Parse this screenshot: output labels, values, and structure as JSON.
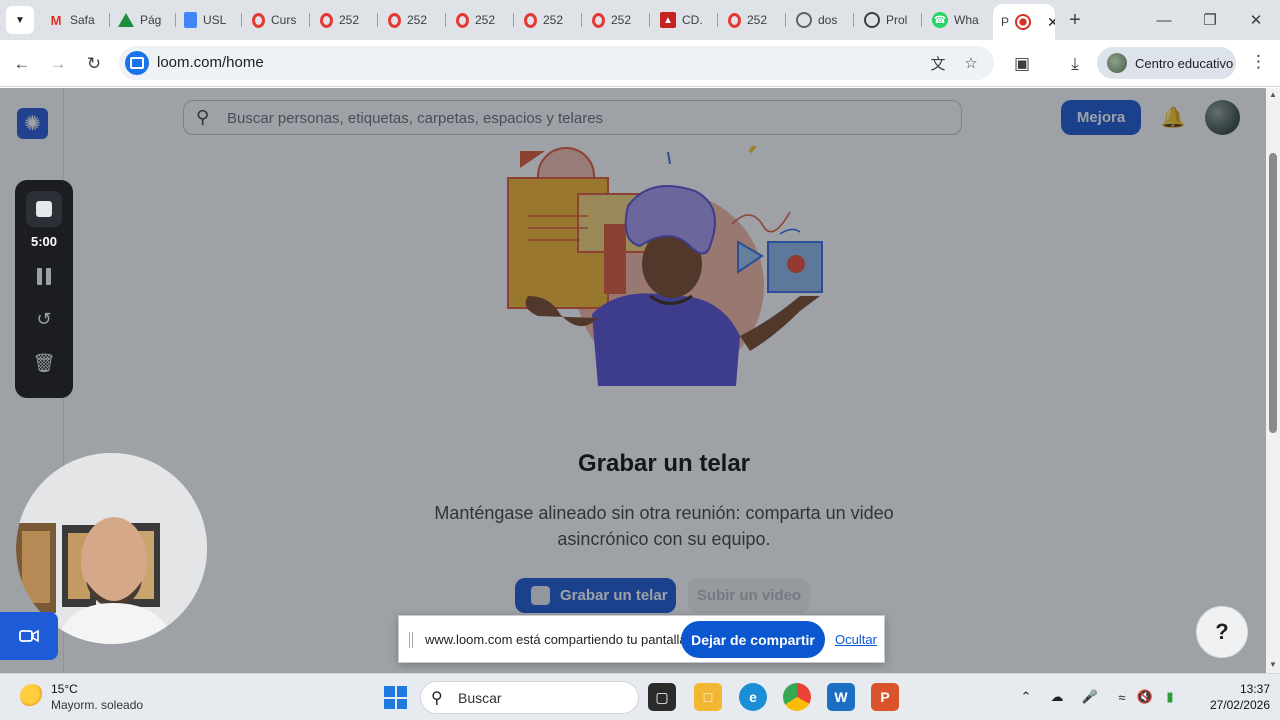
{
  "browser": {
    "tabs": [
      {
        "label": "Safa",
        "icon": "gmail-icon"
      },
      {
        "label": "Pág",
        "icon": "drive-icon"
      },
      {
        "label": "USL",
        "icon": "docs-icon"
      },
      {
        "label": "Curs",
        "icon": "opera-icon"
      },
      {
        "label": "252",
        "icon": "opera-icon"
      },
      {
        "label": "252",
        "icon": "opera-icon"
      },
      {
        "label": "252",
        "icon": "opera-icon"
      },
      {
        "label": "252",
        "icon": "opera-icon"
      },
      {
        "label": "252",
        "icon": "opera-icon"
      },
      {
        "label": "CD.",
        "icon": "pdf-icon"
      },
      {
        "label": "252",
        "icon": "opera-icon"
      },
      {
        "label": "dos",
        "icon": "globe-icon"
      },
      {
        "label": "Prol",
        "icon": "chatgpt-icon"
      },
      {
        "label": "Wha",
        "icon": "whatsapp-icon"
      },
      {
        "label": "P",
        "icon": "recording-icon",
        "active": true
      }
    ],
    "url": "loom.com/home",
    "profile_label": "Centro educativo"
  },
  "loom": {
    "search_placeholder": "Buscar personas, etiquetas, carpetas, espacios y telares",
    "upgrade_label": "Mejora",
    "heading": "Grabar un telar",
    "description": "Manténgase alineado sin otra reunión: comparta un video asincrónico con su equipo.",
    "record_button": "Grabar un telar",
    "upload_button": "Subir un video",
    "help_label": "?"
  },
  "recorder": {
    "timer": "5:00"
  },
  "share_banner": {
    "message": "www.loom.com está compartiendo tu pantalla.",
    "stop_label": "Dejar de compartir",
    "hide_label": "Ocultar"
  },
  "taskbar": {
    "weather_temp": "15°C",
    "weather_desc": "Mayorm. soleado",
    "search_label": "Buscar",
    "time": "13:37",
    "date": "27/02/2026"
  },
  "colors": {
    "loom_blue": "#1e5bd6",
    "chrome_blue": "#0b57d0",
    "overlay": "#191e28"
  }
}
